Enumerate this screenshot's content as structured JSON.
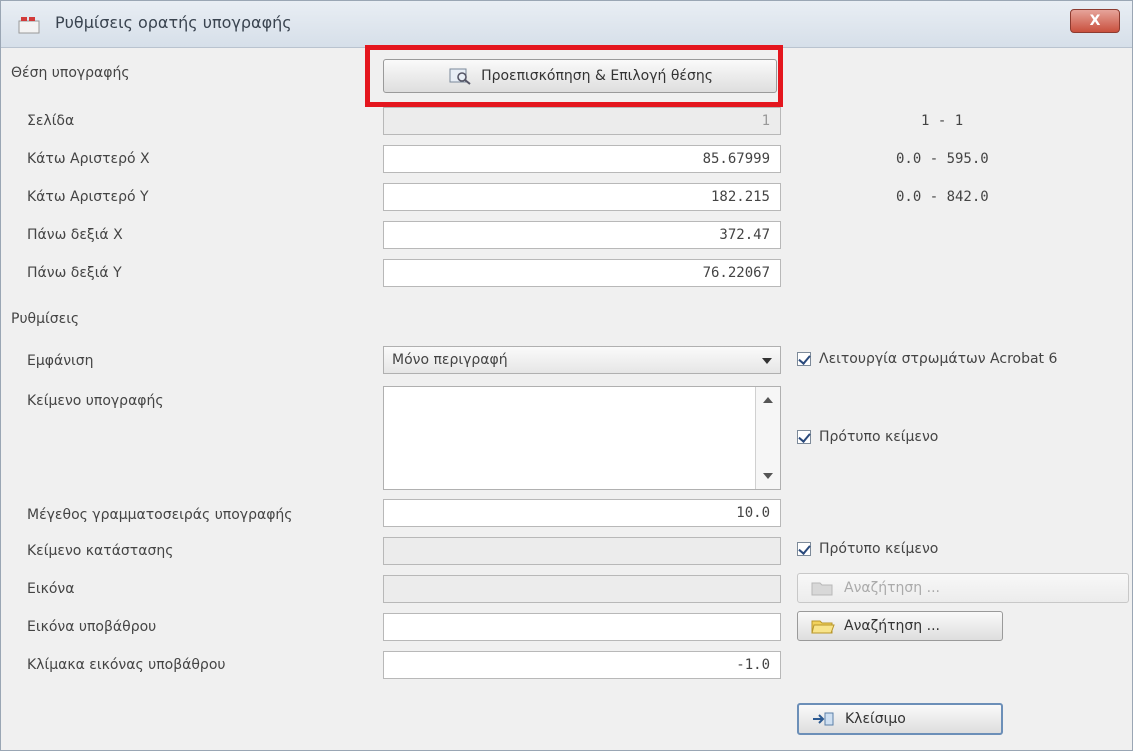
{
  "window": {
    "title": "Ρυθμίσεις ορατής υπογραφής",
    "close_label": "X"
  },
  "position": {
    "label": "Θέση υπογραφής",
    "preview_button": "Προεπισκόπηση & Επιλογή θέσης",
    "rows": [
      {
        "label": "Σελίδα",
        "value": "1",
        "range": "1 - 1",
        "disabled": true
      },
      {
        "label": "Κάτω Αριστερό X",
        "value": "85.67999",
        "range": "0.0 - 595.0",
        "disabled": false
      },
      {
        "label": "Κάτω Αριστερό Y",
        "value": "182.215",
        "range": "0.0 - 842.0",
        "disabled": false
      },
      {
        "label": "Πάνω δεξιά X",
        "value": "372.47",
        "range": "",
        "disabled": false
      },
      {
        "label": "Πάνω δεξιά Y",
        "value": "76.22067",
        "range": "",
        "disabled": false
      }
    ]
  },
  "settings": {
    "section_label": "Ρυθμίσεις",
    "appearance_label": "Εμφάνιση",
    "appearance_value": "Μόνο περιγραφή",
    "acrobat_layers": "Λειτουργία στρωμάτων Acrobat 6",
    "signature_text_label": "Κείμενο υπογραφής",
    "signature_text_value": "",
    "template_text_1": "Πρότυπο κείμενο",
    "font_size_label": "Μέγεθος γραμματοσειράς υπογραφής",
    "font_size_value": "10.0",
    "status_text_label": "Κείμενο κατάστασης",
    "status_text_value": "",
    "template_text_2": "Πρότυπο κείμενο",
    "image_label": "Εικόνα",
    "image_value": "",
    "browse_disabled": "Αναζήτηση ...",
    "background_image_label": "Εικόνα υποβάθρου",
    "background_image_value": "",
    "browse_enabled": "Αναζήτηση ...",
    "background_scale_label": "Κλίμακα εικόνας υποβάθρου",
    "background_scale_value": "-1.0",
    "close_button": "Κλείσιμο"
  }
}
